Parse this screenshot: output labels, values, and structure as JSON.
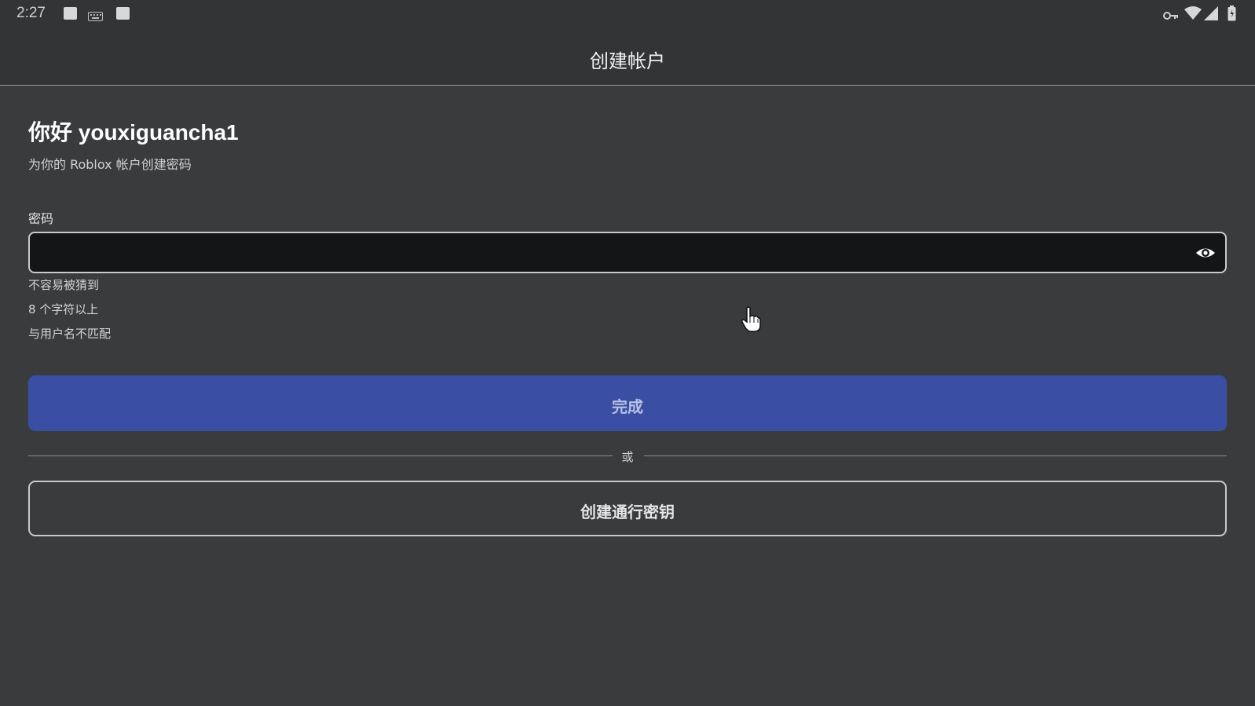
{
  "status_bar": {
    "time": "2:27",
    "left_icons": [
      "app-square-icon",
      "keyboard-icon",
      "app-square-icon"
    ],
    "right_icons": [
      "vpn-key-icon",
      "wifi-icon",
      "signal-icon",
      "battery-icon"
    ]
  },
  "header": {
    "title": "创建帐户"
  },
  "main": {
    "greeting": "你好 youxiguancha1",
    "subtitle": "为你的 Roblox 帐户创建密码",
    "password_label": "密码",
    "password_value": "",
    "eye_icon": "eye-icon",
    "rules": [
      "不容易被猜到",
      "8 个字符以上",
      "与用户名不匹配"
    ],
    "done_label": "完成",
    "divider_text": "或",
    "passkey_label": "创建通行密钥"
  },
  "colors": {
    "background": "#393b3d",
    "header_background": "#323436",
    "input_background": "#141517",
    "primary_button": "#3a4fa3",
    "primary_button_text": "#b7c0e6"
  }
}
